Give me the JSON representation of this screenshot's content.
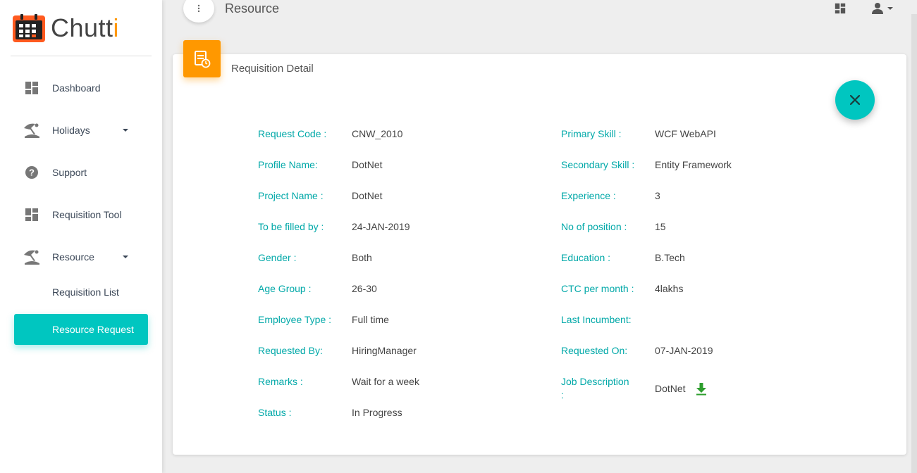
{
  "app": {
    "name_main": "Chutt",
    "name_accent": "i"
  },
  "sidebar": {
    "items": [
      {
        "label": "Dashboard",
        "icon": "dashboard-icon"
      },
      {
        "label": "Holidays",
        "icon": "beach-icon",
        "has_caret": true
      },
      {
        "label": "Support",
        "icon": "help-icon"
      },
      {
        "label": "Requisition Tool",
        "icon": "dashboard-icon"
      },
      {
        "label": "Resource",
        "icon": "beach-icon",
        "has_caret": true
      },
      {
        "label": "Requisition List"
      },
      {
        "label": "Resource Request",
        "active": true
      }
    ]
  },
  "header": {
    "title": "Resource"
  },
  "card": {
    "title": "Requisition Detail",
    "left_fields": [
      {
        "label": "Request Code :",
        "value": "CNW_2010"
      },
      {
        "label": "Profile Name:",
        "value": "DotNet"
      },
      {
        "label": "Project Name :",
        "value": "DotNet"
      },
      {
        "label": "To be filled by :",
        "value": "24-JAN-2019"
      },
      {
        "label": "Gender :",
        "value": "Both"
      },
      {
        "label": "Age Group :",
        "value": "26-30"
      },
      {
        "label": "Employee Type :",
        "value": "Full time"
      },
      {
        "label": "Requested By:",
        "value": "HiringManager"
      },
      {
        "label": "Remarks :",
        "value": "Wait for a week"
      },
      {
        "label": "Status :",
        "value": "In Progress"
      }
    ],
    "right_fields": [
      {
        "label": "Primary Skill :",
        "value": "WCF WebAPI"
      },
      {
        "label": "Secondary Skill :",
        "value": "Entity Framework"
      },
      {
        "label": "Experience :",
        "value": "3"
      },
      {
        "label": "No of position :",
        "value": "15"
      },
      {
        "label": "Education :",
        "value": "B.Tech"
      },
      {
        "label": "CTC per month :",
        "value": "4lakhs"
      },
      {
        "label": "Last Incumbent:",
        "value": ""
      },
      {
        "label": "Requested On:",
        "value": "07-JAN-2019"
      },
      {
        "label": "Job Description",
        "label_line2": ":",
        "value": "DotNet"
      }
    ]
  },
  "colors": {
    "accent": "#00c6c0",
    "label": "#00a8a8",
    "badge": "#ff9800",
    "download": "#2e9e2e"
  }
}
